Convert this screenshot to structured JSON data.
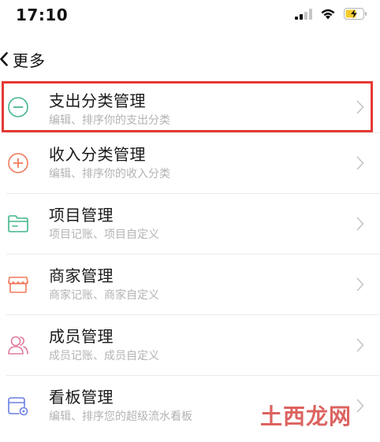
{
  "status_bar": {
    "time": "17:10"
  },
  "nav": {
    "back_icon": "chevron-left-icon",
    "title": "更多"
  },
  "items": [
    {
      "title": "支出分类管理",
      "desc": "编辑、排序你的支出分类",
      "icon": "minus-circle-icon",
      "icon_color": "#43b58a",
      "highlighted": true
    },
    {
      "title": "收入分类管理",
      "desc": "编辑、排序你的收入分类",
      "icon": "plus-circle-icon",
      "icon_color": "#f07a5c"
    },
    {
      "title": "项目管理",
      "desc": "项目记账、项目自定义",
      "icon": "folder-icon",
      "icon_color": "#43b58a"
    },
    {
      "title": "商家管理",
      "desc": "商家记账、商家自定义",
      "icon": "shop-icon",
      "icon_color": "#f07a5c"
    },
    {
      "title": "成员管理",
      "desc": "成员记账、成员自定义",
      "icon": "members-icon",
      "icon_color": "#e27ba0"
    },
    {
      "title": "看板管理",
      "desc": "编辑、排序您的超级流水看板",
      "icon": "board-icon",
      "icon_color": "#6b7fe0"
    }
  ],
  "highlight_color": "#e53935",
  "watermark": "土西龙网"
}
